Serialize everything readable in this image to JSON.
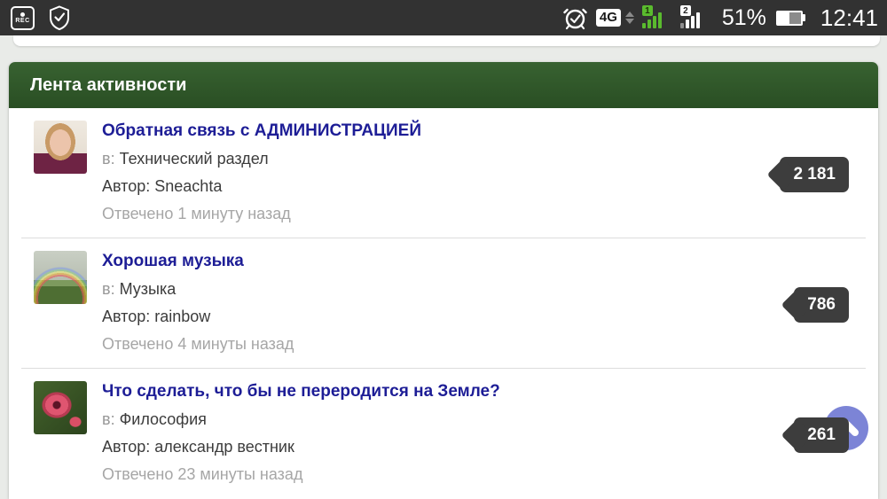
{
  "status_bar": {
    "rec_label": "REC",
    "network_type": "4G",
    "sim1_badge": "1",
    "sim2_badge": "2",
    "battery_percent": "51%",
    "time": "12:41"
  },
  "feed": {
    "header_title": "Лента активности"
  },
  "topics": [
    {
      "title": "Обратная связь с АДМИНИСТРАЦИЕЙ",
      "category_label": "в:",
      "category": "Технический раздел",
      "author_label": "Автор:",
      "author": "Sneachta",
      "replied": "Отвечено 1 минуту назад",
      "count": "2 181",
      "avatar": "woman-portrait"
    },
    {
      "title": "Хорошая музыка",
      "category_label": "в:",
      "category": "Музыка",
      "author_label": "Автор:",
      "author": "rainbow",
      "replied": "Отвечено 4 минуты назад",
      "count": "786",
      "avatar": "rainbow-landscape"
    },
    {
      "title": "Что сделать, что бы не переродится на Земле?",
      "category_label": "в:",
      "category": "Философия",
      "author_label": "Автор:",
      "author": "александр вестник",
      "replied": "Отвечено 23 минуты назад",
      "count": "261",
      "avatar": "red-flower"
    }
  ],
  "colors": {
    "header_green": "#2e5528",
    "title_blue": "#1d1d96",
    "badge_bg": "#3d3d3d",
    "page_bg": "#e9ebe8",
    "status_bg": "#323232",
    "scroll_button": "#7179d3",
    "sim_green": "#5abb2e"
  }
}
